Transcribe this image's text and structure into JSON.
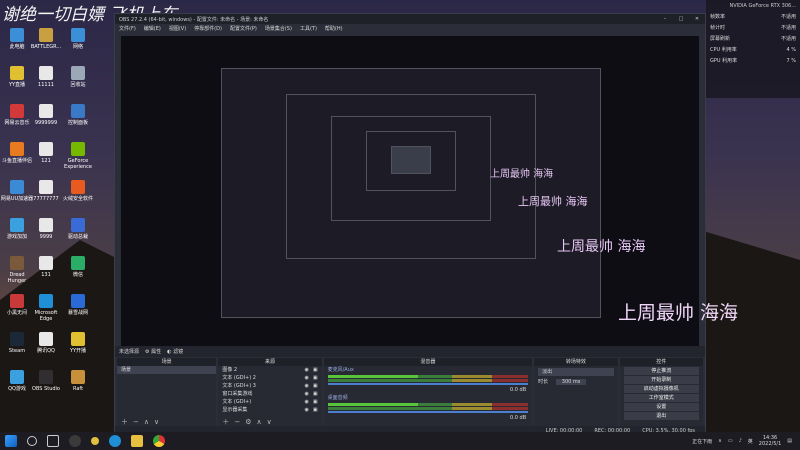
{
  "overlay": {
    "top_left_text": "谢绝一切白嫖 飞机上车",
    "watermark": "上周最帅 海海"
  },
  "desktop_icons": [
    {
      "label": "此电脑",
      "color": "#3b8fd6"
    },
    {
      "label": "BATTLEGR...",
      "color": "#c8a040"
    },
    {
      "label": "网络",
      "color": "#3b8fd6"
    },
    {
      "label": "YY直播",
      "color": "#e0c030"
    },
    {
      "label": "11111",
      "color": "#e8e8e8"
    },
    {
      "label": "回收站",
      "color": "#9aa8b8"
    },
    {
      "label": "网易云音乐",
      "color": "#d23a3a"
    },
    {
      "label": "9999999",
      "color": "#e8e8e8"
    },
    {
      "label": "控制面板",
      "color": "#3a78c8"
    },
    {
      "label": "斗鱼直播伴侣",
      "color": "#e87a20"
    },
    {
      "label": "121",
      "color": "#e8e8e8"
    },
    {
      "label": "GeForce Experience",
      "color": "#76b900"
    },
    {
      "label": "网易UU加速器",
      "color": "#3a8ad6"
    },
    {
      "label": "77777777",
      "color": "#e8e8e8"
    },
    {
      "label": "火绒安全软件",
      "color": "#e85a20"
    },
    {
      "label": "游戏加加",
      "color": "#3aa0e0"
    },
    {
      "label": "9999",
      "color": "#e8e8e8"
    },
    {
      "label": "驱动总裁",
      "color": "#3a6ad6"
    },
    {
      "label": "Dread Hunger",
      "color": "#7a5a3a"
    },
    {
      "label": "131",
      "color": "#e8e8e8"
    },
    {
      "label": "微信",
      "color": "#2aae67"
    },
    {
      "label": "小黑无间",
      "color": "#c83a3a"
    },
    {
      "label": "Microsoft Edge",
      "color": "#1f8fd6"
    },
    {
      "label": "暴雪战网",
      "color": "#2a6ad6"
    },
    {
      "label": "Steam",
      "color": "#1b2838"
    },
    {
      "label": "腾讯QQ",
      "color": "#e8e8e8"
    },
    {
      "label": "YY开播",
      "color": "#e0c030"
    },
    {
      "label": "QQ游戏",
      "color": "#3aa0e0"
    },
    {
      "label": "OBS Studio",
      "color": "#302e31"
    },
    {
      "label": "Raft",
      "color": "#c8903a"
    }
  ],
  "obs": {
    "title": "OBS 27.2.4 (64-bit, windows) - 配置文件: 未命名 - 场景: 未命名",
    "menu": [
      "文件(F)",
      "编辑(E)",
      "视图(V)",
      "停靠部件(D)",
      "配置文件(P)",
      "场景集合(S)",
      "工具(T)",
      "帮助(H)"
    ],
    "dock_bar": {
      "source_label": "未选择源",
      "properties": "属性",
      "filters": "滤镜"
    },
    "scenes": {
      "header": "场景",
      "items": [
        "场景"
      ]
    },
    "sources": {
      "header": "来源",
      "items": [
        "图像 2",
        "文本 (GDI+) 2",
        "文本 (GDI+) 3",
        "窗口采集游戏",
        "文本 (GDI+)",
        "显示器采集"
      ]
    },
    "mixer": {
      "header": "混音器",
      "tracks": [
        {
          "name": "麦克风/Aux",
          "db": "0.0 dB"
        },
        {
          "name": "桌面音频",
          "db": "0.0 dB"
        }
      ]
    },
    "transitions": {
      "header": "转场特效",
      "type": "淡出",
      "duration_label": "时长",
      "duration": "300 ms"
    },
    "controls": {
      "header": "控件",
      "buttons": [
        "停止推流",
        "开始录制",
        "启动虚拟摄像机",
        "工作室模式",
        "设置",
        "退出"
      ]
    },
    "status": {
      "live": "LIVE: 00:00:00",
      "rec": "REC: 00:00:00",
      "cpu": "CPU: 3.5%, 30.00 fps"
    }
  },
  "perf_panel": {
    "title": "NVIDIA GeForce RTX 306...",
    "rows": [
      {
        "label": "帧数率",
        "value": "不适用"
      },
      {
        "label": "帧计时",
        "value": "不适用"
      },
      {
        "label": "屏幕刷新",
        "value": "不适用"
      },
      {
        "label": "CPU 利用率",
        "value": "4 %"
      },
      {
        "label": "GPU 利用率",
        "value": "7 %"
      }
    ]
  },
  "taskbar": {
    "tray_text": "正在下雨",
    "ime": "英",
    "time": "14:36",
    "date": "2022/5/1"
  }
}
